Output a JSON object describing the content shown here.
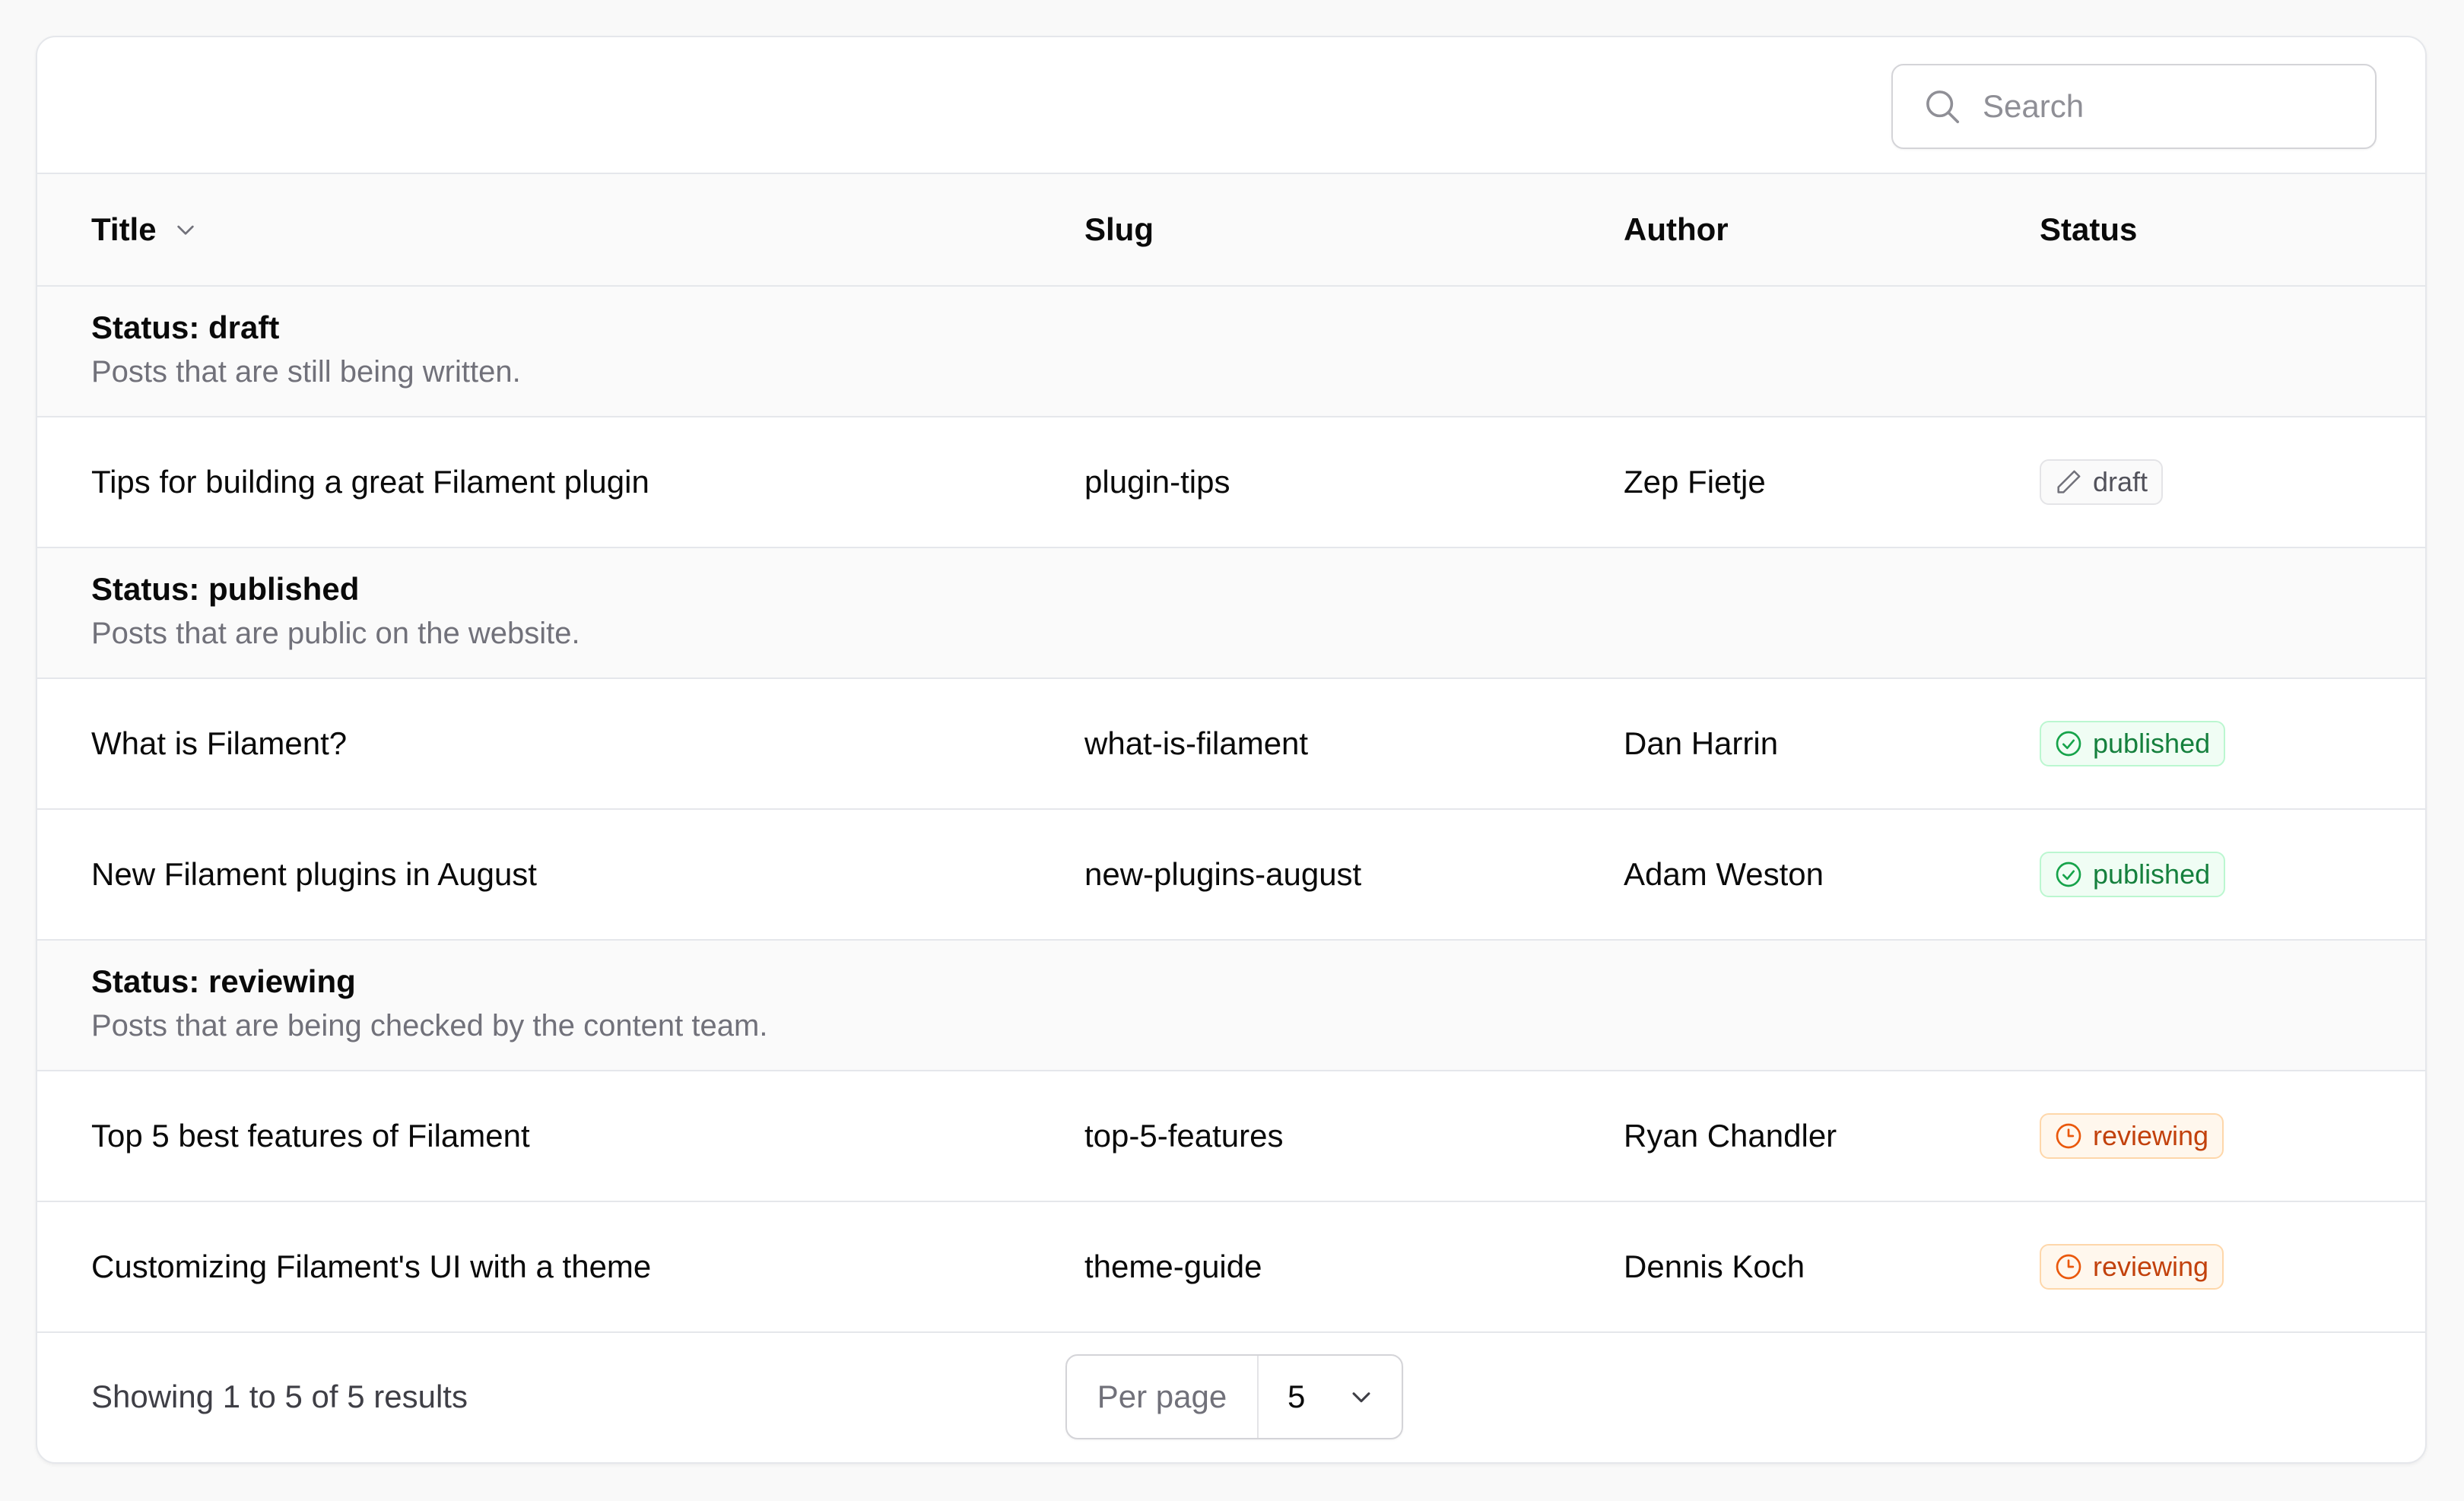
{
  "search": {
    "placeholder": "Search"
  },
  "columns": {
    "title": "Title",
    "slug": "Slug",
    "author": "Author",
    "status": "Status"
  },
  "groups": [
    {
      "title": "Status: draft",
      "description": "Posts that are still being written.",
      "rows": [
        {
          "title": "Tips for building a great Filament plugin",
          "slug": "plugin-tips",
          "author": "Zep Fietje",
          "status": "draft"
        }
      ]
    },
    {
      "title": "Status: published",
      "description": "Posts that are public on the website.",
      "rows": [
        {
          "title": "What is Filament?",
          "slug": "what-is-filament",
          "author": "Dan Harrin",
          "status": "published"
        },
        {
          "title": "New Filament plugins in August",
          "slug": "new-plugins-august",
          "author": "Adam Weston",
          "status": "published"
        }
      ]
    },
    {
      "title": "Status: reviewing",
      "description": "Posts that are being checked by the content team.",
      "rows": [
        {
          "title": "Top 5 best features of Filament",
          "slug": "top-5-features",
          "author": "Ryan Chandler",
          "status": "reviewing"
        },
        {
          "title": "Customizing Filament's UI with a theme",
          "slug": "theme-guide",
          "author": "Dennis Koch",
          "status": "reviewing"
        }
      ]
    }
  ],
  "footer": {
    "results": "Showing 1 to 5 of 5 results",
    "per_page_label": "Per page",
    "per_page_value": "5"
  },
  "icons": {
    "search": "search-icon",
    "sort": "chevron-down-icon",
    "draft": "pencil-icon",
    "published": "check-circle-icon",
    "reviewing": "clock-icon",
    "select": "chevron-down-icon"
  },
  "colors": {
    "draft": "#52525b",
    "published": "#15803d",
    "reviewing": "#c2410c"
  }
}
